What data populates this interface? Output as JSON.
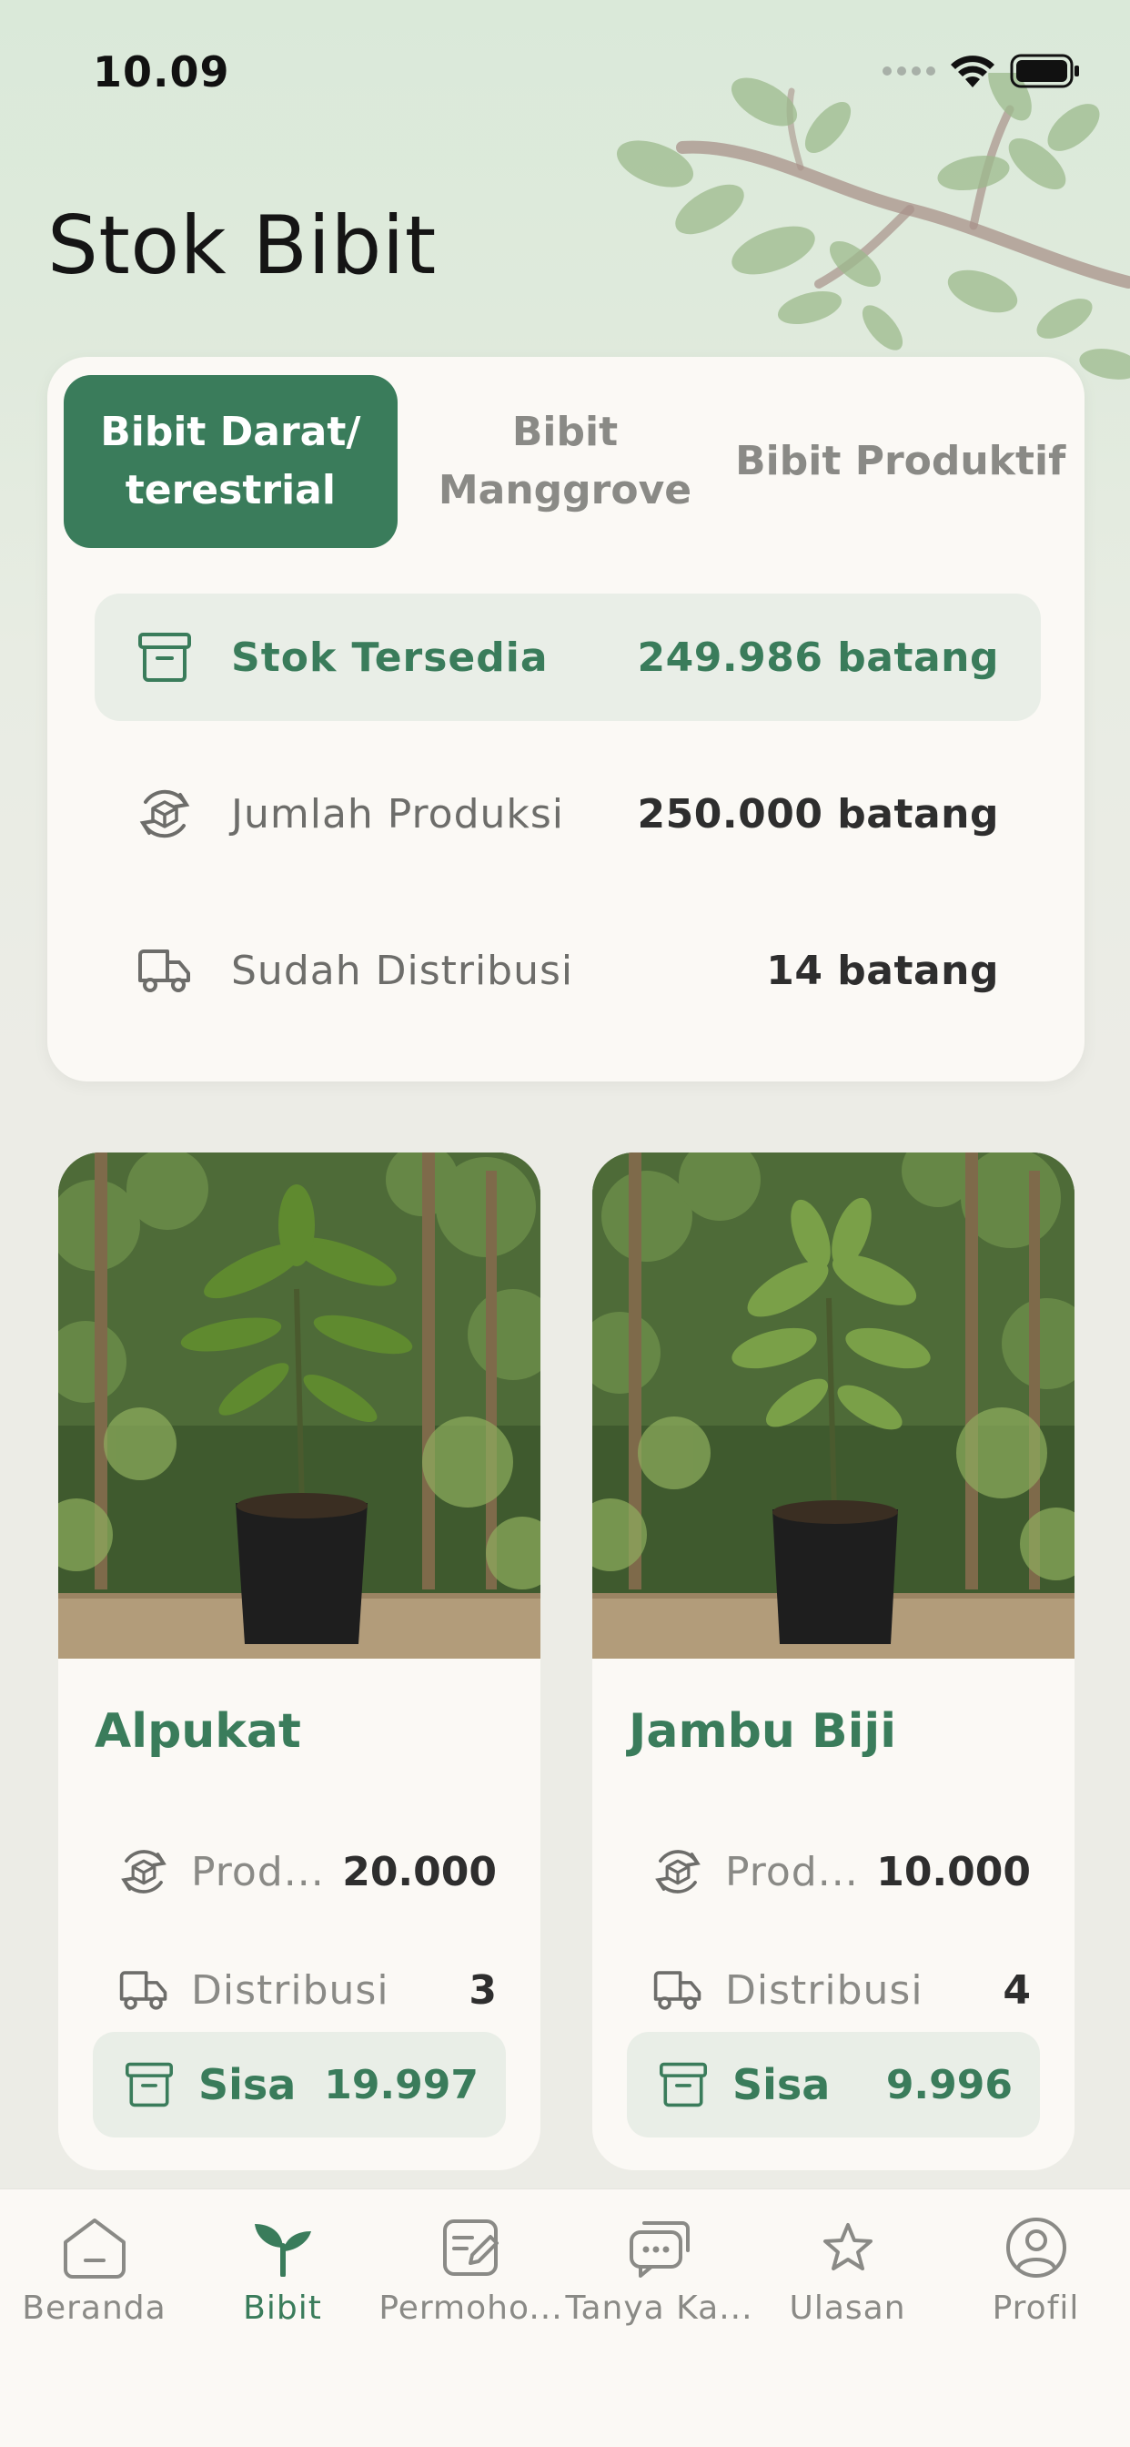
{
  "status_bar": {
    "time": "10.09"
  },
  "page": {
    "title": "Stok Bibit"
  },
  "tabs": [
    {
      "label": "Bibit Darat/ terestrial",
      "active": true
    },
    {
      "label": "Bibit Manggrove",
      "active": false
    },
    {
      "label": "Bibit Produktif",
      "active": false
    }
  ],
  "summary": {
    "available": {
      "label": "Stok Tersedia",
      "value": "249.986 batang",
      "icon": "archive-box-icon"
    },
    "production": {
      "label": "Jumlah Produksi",
      "value": "250.000 batang",
      "icon": "production-cycle-icon"
    },
    "distributed": {
      "label": "Sudah Distribusi",
      "value": "14 batang",
      "icon": "truck-icon"
    }
  },
  "products": [
    {
      "name": "Alpukat",
      "production_label": "Prod...",
      "production_value": "20.000",
      "distribution_label": "Distribusi",
      "distribution_value": "3",
      "remaining_label": "Sisa",
      "remaining_value": "19.997"
    },
    {
      "name": "Jambu Biji",
      "production_label": "Prod...",
      "production_value": "10.000",
      "distribution_label": "Distribusi",
      "distribution_value": "4",
      "remaining_label": "Sisa",
      "remaining_value": "9.996"
    }
  ],
  "nav": [
    {
      "label": "Beranda",
      "icon": "home-icon",
      "active": false
    },
    {
      "label": "Bibit",
      "icon": "sprout-icon",
      "active": true
    },
    {
      "label": "Permoho...",
      "icon": "edit-note-icon",
      "active": false
    },
    {
      "label": "Tanya Ka...",
      "icon": "chat-bubbles-icon",
      "active": false
    },
    {
      "label": "Ulasan",
      "icon": "star-icon",
      "active": false
    },
    {
      "label": "Profil",
      "icon": "user-circle-icon",
      "active": false
    }
  ],
  "colors": {
    "brand_green": "#3a7c5b",
    "card_bg": "#fbf9f5",
    "highlight_bg": "#e9eee7",
    "page_bg": "#ecece6"
  }
}
